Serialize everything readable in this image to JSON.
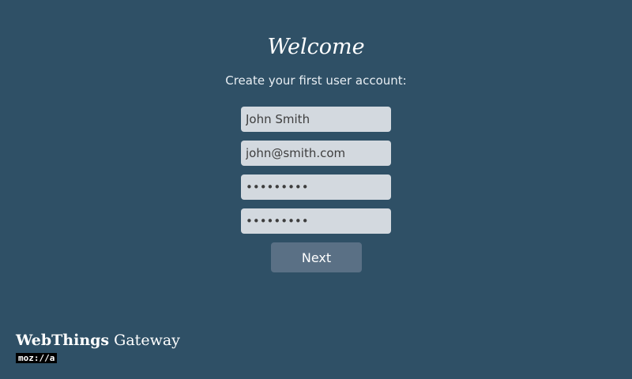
{
  "title": "Welcome",
  "subtitle": "Create your first user account:",
  "form": {
    "name_value": "John Smith",
    "email_value": "john@smith.com",
    "password_value": "•••••••••",
    "confirm_password_value": "•••••••••",
    "next_label": "Next"
  },
  "brand": {
    "strong": "WebThings",
    "rest": " Gateway",
    "logo": "moz://a"
  },
  "colors": {
    "background": "#2f5066",
    "input": "#d3d9df",
    "button": "#5a7085"
  }
}
